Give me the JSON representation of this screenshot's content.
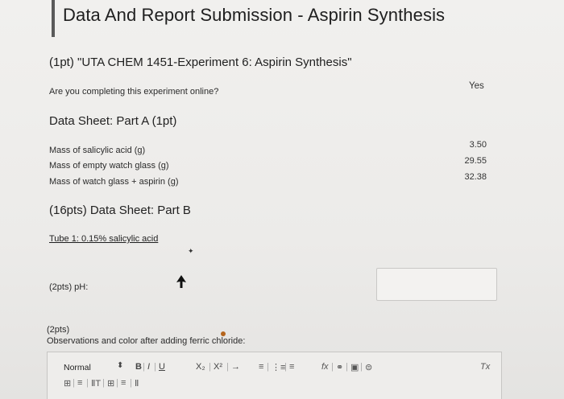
{
  "header": {
    "title": "Data And Report Submission - Aspirin Synthesis"
  },
  "section": {
    "title": "(1pt) \"UTA CHEM 1451-Experiment 6: Aspirin Synthesis\""
  },
  "online": {
    "question": "Are you completing this experiment online?",
    "answer": "Yes"
  },
  "part_a": {
    "title": "Data Sheet: Part A (1pt)",
    "rows": [
      {
        "label": "Mass of salicylic acid (g)",
        "value": "3.50"
      },
      {
        "label": "Mass of empty watch glass (g)",
        "value": "29.55"
      },
      {
        "label": "Mass of watch glass + aspirin (g)",
        "value": "32.38"
      }
    ]
  },
  "part_b": {
    "title": "(16pts) Data Sheet: Part B",
    "tube_label": "Tube 1: 0.15% salicylic acid",
    "ph_label": "(2pts) pH:",
    "ph_value": "",
    "obs_points": "(2pts)",
    "obs_label": "Observations and color after adding ferric chloride:"
  },
  "editor": {
    "style_value": "Normal",
    "toolbar": {
      "bold": "B",
      "italic": "I",
      "underline": "U",
      "subscript": "X₂",
      "superscript": "X²",
      "arrow": "→",
      "align_left": "≡",
      "ordered_list": "⋮≡",
      "bullet_list": "≡",
      "formula": "fx",
      "link": "⚭",
      "image": "▣",
      "embed": "⊜",
      "clear_format": "Tx",
      "table": "⊞",
      "row2_a": "≡",
      "row2_b": "ⅡT",
      "row2_c": "⊞",
      "row2_d": "≡",
      "row2_e": "Ⅱ"
    }
  }
}
